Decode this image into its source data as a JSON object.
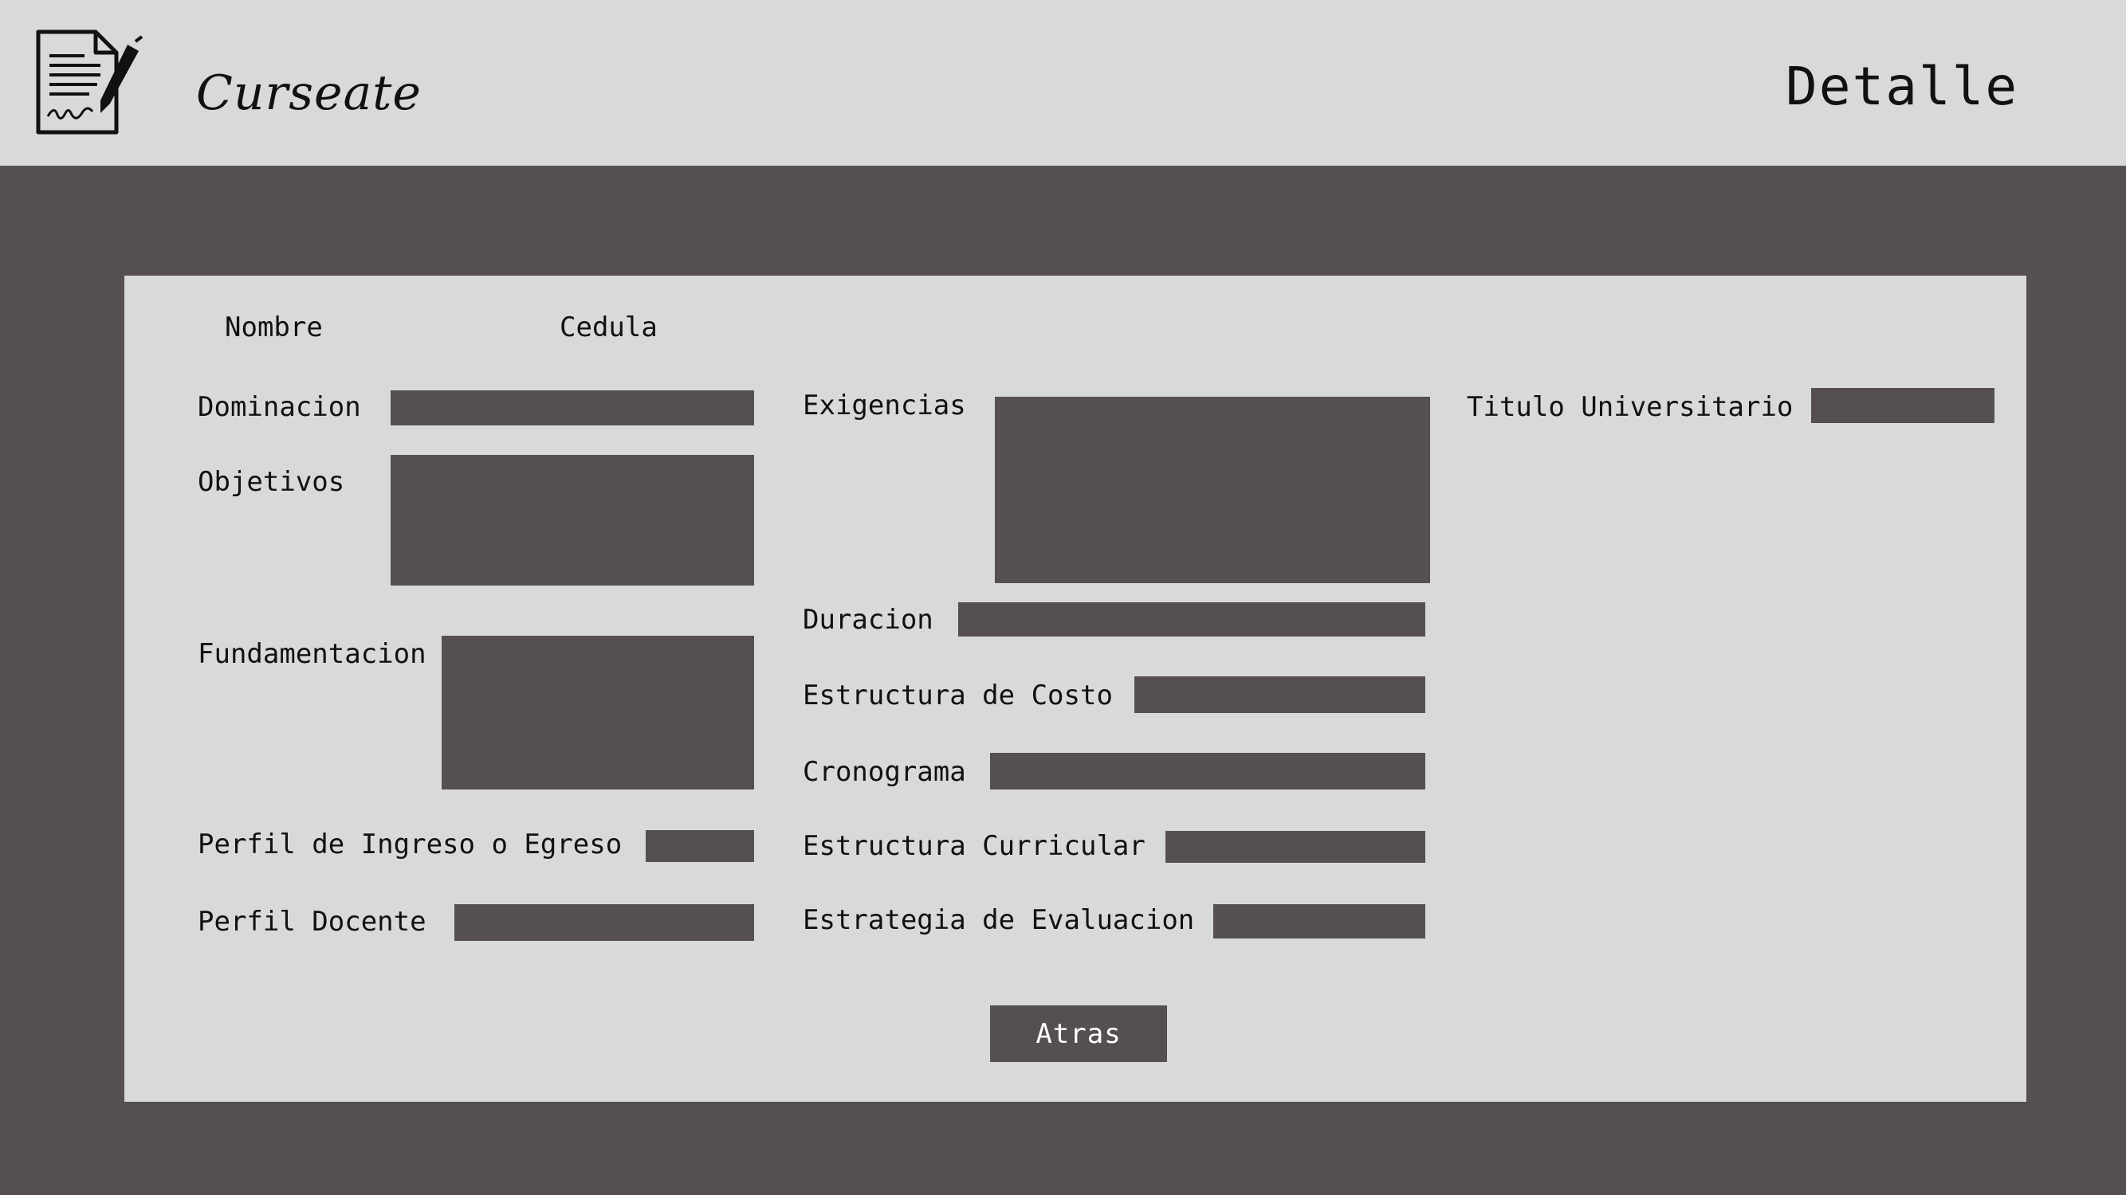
{
  "header": {
    "brand": "Curseate",
    "title": "Detalle"
  },
  "icons": {
    "logo": "document-signature-icon"
  },
  "colors": {
    "header_bg": "#d9d9d9",
    "page_bg": "#564f4f",
    "field_bg": "#564f4f",
    "text": "#111111"
  },
  "form": {
    "nombre_label": "Nombre",
    "cedula_label": "Cedula",
    "dominacion_label": "Dominacion",
    "objetivos_label": "Objetivos",
    "fundamentacion_label": "Fundamentacion",
    "perfil_ingreso_label": "Perfil de Ingreso o Egreso",
    "perfil_docente_label": "Perfil Docente",
    "exigencias_label": "Exigencias",
    "duracion_label": "Duracion",
    "estructura_costo_label": "Estructura de Costo",
    "cronograma_label": "Cronograma",
    "estructura_curricular_label": "Estructura Curricular",
    "estrategia_evaluacion_label": "Estrategia de Evaluacion",
    "titulo_universitario_label": "Titulo Universitario"
  },
  "actions": {
    "back_label": "Atras"
  }
}
